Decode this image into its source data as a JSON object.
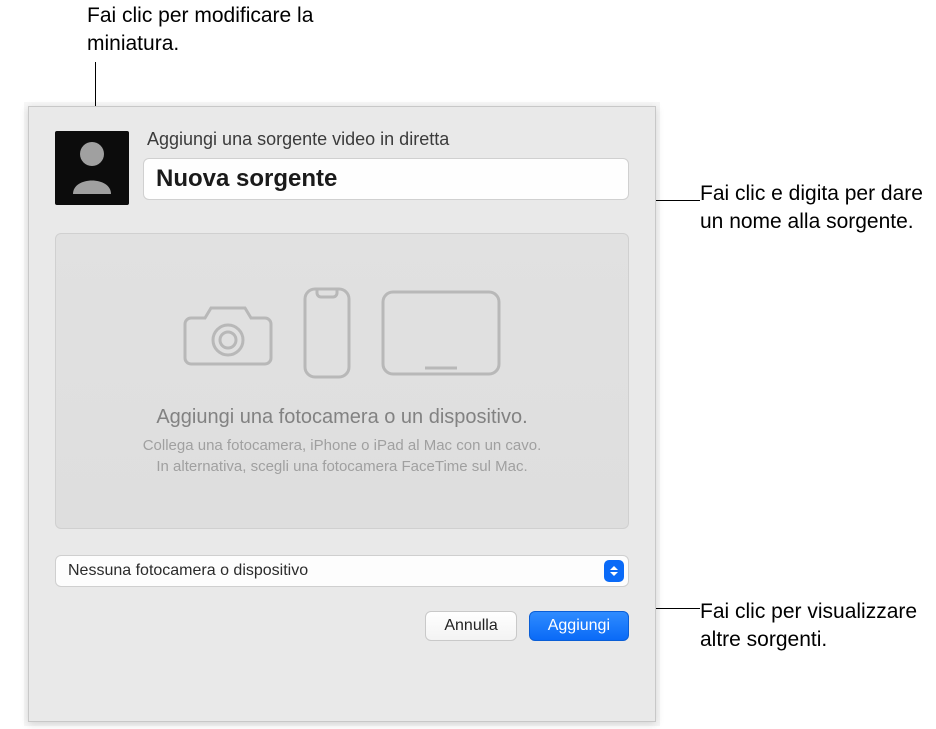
{
  "annotations": {
    "thumbnail": "Fai clic per modificare la miniatura.",
    "name_field": "Fai clic e digita per dare un nome alla sorgente.",
    "select": "Fai clic per visualizzare altre sorgenti."
  },
  "dialog": {
    "title": "Aggiungi una sorgente video in diretta",
    "name_value": "Nuova sorgente",
    "preview": {
      "heading": "Aggiungi una fotocamera o un dispositivo.",
      "line1": "Collega una fotocamera, iPhone o iPad al Mac con un cavo.",
      "line2": "In alternativa, scegli una fotocamera FaceTime sul Mac."
    },
    "select_value": "Nessuna fotocamera o dispositivo",
    "buttons": {
      "cancel": "Annulla",
      "add": "Aggiungi"
    }
  },
  "icons": {
    "thumbnail": "person-silhouette-icon",
    "camera": "camera-icon",
    "phone": "phone-icon",
    "tablet": "tablet-icon",
    "select_arrows": "updown-arrows-icon"
  }
}
